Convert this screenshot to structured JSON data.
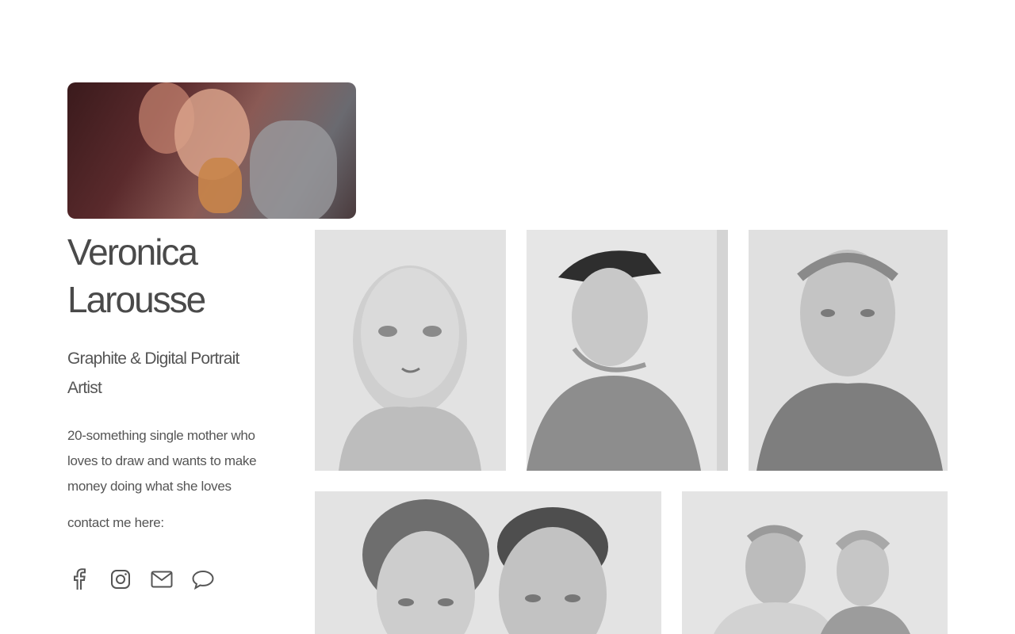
{
  "profile": {
    "photo_alt": "Veronica Larousse profile photo",
    "name": "Veronica Larousse",
    "tagline": "Graphite & Digital Portrait Artist",
    "bio": "20-something single mother who loves to draw and wants to make money doing what she loves",
    "contact_label": "contact me here:"
  },
  "social_links": [
    {
      "icon": "facebook-icon",
      "label": "Facebook"
    },
    {
      "icon": "instagram-icon",
      "label": "Instagram"
    },
    {
      "icon": "email-icon",
      "label": "Email"
    },
    {
      "icon": "message-icon",
      "label": "Message"
    }
  ],
  "gallery": [
    {
      "subject": "baby portrait"
    },
    {
      "subject": "man in cap profile portrait"
    },
    {
      "subject": "young man portrait"
    },
    {
      "subject": "elderly couple portrait"
    },
    {
      "subject": "smiling couple portrait"
    }
  ]
}
